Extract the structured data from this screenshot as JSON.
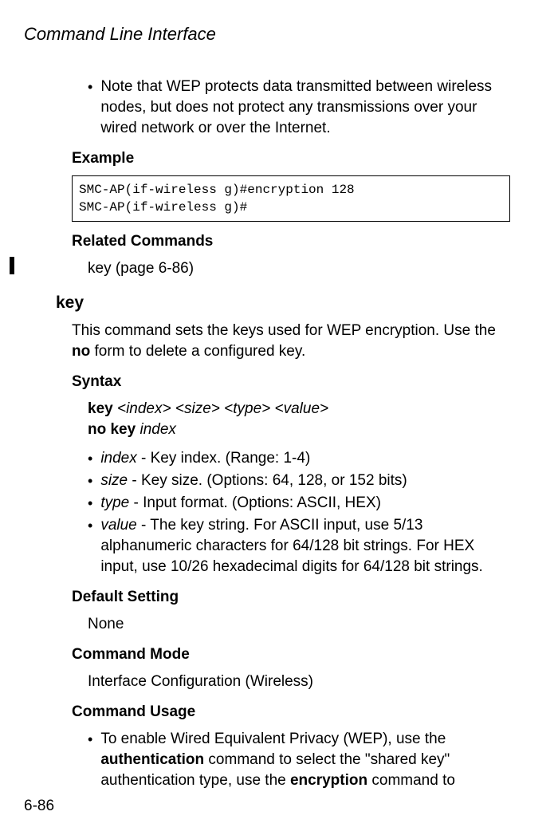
{
  "header": {
    "title": "Command Line Interface"
  },
  "note_bullet": "Note that WEP protects data transmitted between wireless nodes, but does not protect any transmissions over your wired network or over the Internet.",
  "example": {
    "heading": "Example",
    "code": "SMC-AP(if-wireless g)#encryption 128\nSMC-AP(if-wireless g)#"
  },
  "related": {
    "heading": "Related Commands",
    "text": "key (page 6-86)"
  },
  "key_cmd": {
    "name": "key",
    "description_part1": "This command sets the keys used for WEP encryption. Use the ",
    "description_bold": "no",
    "description_part2": " form to delete a configured key.",
    "syntax": {
      "heading": "Syntax",
      "line1_bold": "key",
      "line1_rest": " <index> <size> <type> <value>",
      "line2_bold": "no key",
      "line2_italic": " index"
    },
    "params": {
      "index_name": "index",
      "index_desc": " - Key index. (Range: 1-4)",
      "size_name": "size",
      "size_desc": " - Key size. (Options: 64, 128, or 152 bits)",
      "type_name": "type",
      "type_desc": " - Input format. (Options: ASCII, HEX)",
      "value_name": "value",
      "value_desc": " - The key string. For ASCII input, use 5/13 alphanumeric characters for 64/128 bit strings. For HEX input, use 10/26 hexadecimal digits for 64/128 bit strings."
    },
    "default": {
      "heading": "Default Setting",
      "text": "None"
    },
    "mode": {
      "heading": "Command Mode",
      "text": "Interface Configuration (Wireless)"
    },
    "usage": {
      "heading": "Command Usage",
      "bullet_part1": "To enable Wired Equivalent Privacy (WEP), use the ",
      "bullet_bold1": "authentication",
      "bullet_part2": " command to select the \"shared key\" authentication type, use the ",
      "bullet_bold2": "encryption",
      "bullet_part3": " command to"
    }
  },
  "page_number": "6-86"
}
